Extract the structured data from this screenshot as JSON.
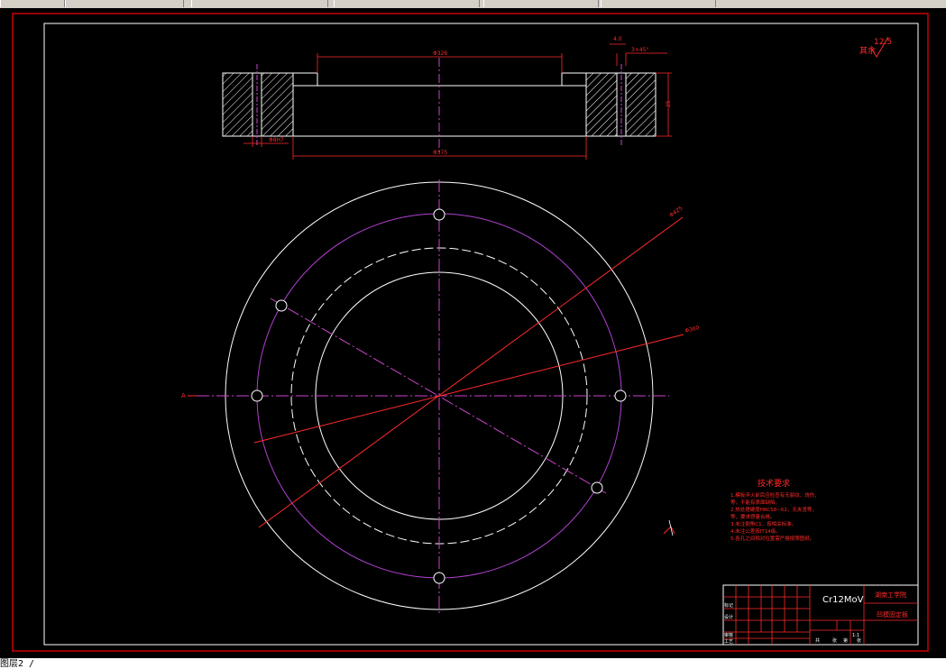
{
  "colors": {
    "background": "#000000",
    "outer_frame": "#cc0000",
    "inner_frame": "#ffffff",
    "geometry": "#ffffff",
    "centerline": "#cc44cc",
    "pitch_circle": "#b040d0",
    "dimension": "#ff2a2a",
    "toolbar": "#d4d0c8"
  },
  "drawing": {
    "surface_roughness_label": "其余",
    "surface_roughness_value": "12.5",
    "section_marker": "A",
    "material": "Cr12MoV",
    "dims": {
      "top_width": "Φ326",
      "bottom_width": "Φ375",
      "hole": "Φ8H7",
      "height": "25",
      "right_top_a": "4.0",
      "right_top_b": "3×45°",
      "leader_1": "Φ425",
      "leader_2": "Φ360"
    },
    "tech_title": "技术要求",
    "tech_notes": [
      "1.模板淬火前后应检查有无裂纹、烧伤，",
      "  等，不能有表面缺陷。",
      "2.热处理硬度HRC58~62，无夹渣等，",
      "  等，要求质量合格。",
      "3.未注倒角C1，按相关标准。",
      "4.未注公差按IT14级。",
      "5.各孔之间相对位置需严格按照图纸。"
    ],
    "title_block": {
      "company": "湖南工学院",
      "part_name": "凹模固定板",
      "material_cell": "Cr12MoV",
      "scale": "1:1",
      "row_labels": [
        "标记",
        "设计",
        "审核",
        "工艺"
      ],
      "footer": [
        "共",
        "张",
        "第",
        "张"
      ]
    }
  },
  "statusbar": {
    "text": "图层2 /"
  }
}
